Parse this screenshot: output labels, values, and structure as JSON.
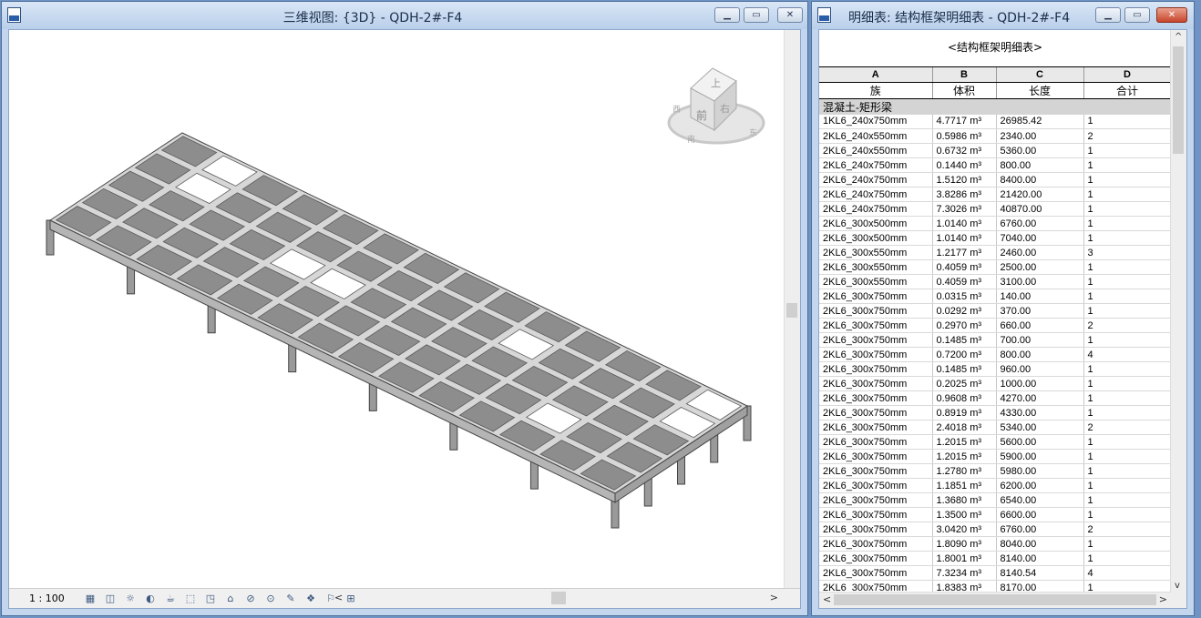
{
  "window_3d": {
    "title": "三维视图: {3D} - QDH-2#-F4",
    "scale": "1 : 100",
    "viewcube": {
      "top": "上",
      "front": "前",
      "right": "右",
      "ring_left": "西",
      "ring_front": "南",
      "ring_right": "东"
    },
    "view_controls": [
      "detail-level-icon",
      "visual-style-icon",
      "sun-path-icon",
      "shadows-icon",
      "render-icon",
      "crop-view-icon",
      "show-crop-icon",
      "unlock-3d-icon",
      "temporary-hide-icon",
      "reveal-hidden-icon",
      "highlight-icon",
      "analytical-model-icon",
      "worksharing-icon",
      "design-options-icon"
    ]
  },
  "window_schedule": {
    "title": "明细表: 结构框架明细表 - QDH-2#-F4",
    "schedule_title": "<结构框架明细表>",
    "column_letters": [
      "A",
      "B",
      "C",
      "D"
    ],
    "column_headers": [
      "族",
      "体积",
      "长度",
      "合计"
    ],
    "group_name": "混凝土-矩形梁",
    "rows": [
      [
        "1KL6_240x750mm",
        "4.7717 m³",
        "26985.42",
        "1"
      ],
      [
        "2KL6_240x550mm",
        "0.5986 m³",
        "2340.00",
        "2"
      ],
      [
        "2KL6_240x550mm",
        "0.6732 m³",
        "5360.00",
        "1"
      ],
      [
        "2KL6_240x750mm",
        "0.1440 m³",
        "800.00",
        "1"
      ],
      [
        "2KL6_240x750mm",
        "1.5120 m³",
        "8400.00",
        "1"
      ],
      [
        "2KL6_240x750mm",
        "3.8286 m³",
        "21420.00",
        "1"
      ],
      [
        "2KL6_240x750mm",
        "7.3026 m³",
        "40870.00",
        "1"
      ],
      [
        "2KL6_300x500mm",
        "1.0140 m³",
        "6760.00",
        "1"
      ],
      [
        "2KL6_300x500mm",
        "1.0140 m³",
        "7040.00",
        "1"
      ],
      [
        "2KL6_300x550mm",
        "1.2177 m³",
        "2460.00",
        "3"
      ],
      [
        "2KL6_300x550mm",
        "0.4059 m³",
        "2500.00",
        "1"
      ],
      [
        "2KL6_300x550mm",
        "0.4059 m³",
        "3100.00",
        "1"
      ],
      [
        "2KL6_300x750mm",
        "0.0315 m³",
        "140.00",
        "1"
      ],
      [
        "2KL6_300x750mm",
        "0.0292 m³",
        "370.00",
        "1"
      ],
      [
        "2KL6_300x750mm",
        "0.2970 m³",
        "660.00",
        "2"
      ],
      [
        "2KL6_300x750mm",
        "0.1485 m³",
        "700.00",
        "1"
      ],
      [
        "2KL6_300x750mm",
        "0.7200 m³",
        "800.00",
        "4"
      ],
      [
        "2KL6_300x750mm",
        "0.1485 m³",
        "960.00",
        "1"
      ],
      [
        "2KL6_300x750mm",
        "0.2025 m³",
        "1000.00",
        "1"
      ],
      [
        "2KL6_300x750mm",
        "0.9608 m³",
        "4270.00",
        "1"
      ],
      [
        "2KL6_300x750mm",
        "0.8919 m³",
        "4330.00",
        "1"
      ],
      [
        "2KL6_300x750mm",
        "2.4018 m³",
        "5340.00",
        "2"
      ],
      [
        "2KL6_300x750mm",
        "1.2015 m³",
        "5600.00",
        "1"
      ],
      [
        "2KL6_300x750mm",
        "1.2015 m³",
        "5900.00",
        "1"
      ],
      [
        "2KL6_300x750mm",
        "1.2780 m³",
        "5980.00",
        "1"
      ],
      [
        "2KL6_300x750mm",
        "1.1851 m³",
        "6200.00",
        "1"
      ],
      [
        "2KL6_300x750mm",
        "1.3680 m³",
        "6540.00",
        "1"
      ],
      [
        "2KL6_300x750mm",
        "1.3500 m³",
        "6600.00",
        "1"
      ],
      [
        "2KL6_300x750mm",
        "3.0420 m³",
        "6760.00",
        "2"
      ],
      [
        "2KL6_300x750mm",
        "1.8090 m³",
        "8040.00",
        "1"
      ],
      [
        "2KL6_300x750mm",
        "1.8001 m³",
        "8140.00",
        "1"
      ],
      [
        "2KL6_300x750mm",
        "7.3234 m³",
        "8140.54",
        "4"
      ],
      [
        "2KL6_300x750mm",
        "1.8383 m³",
        "8170.00",
        "1"
      ]
    ]
  },
  "colors": {
    "window_frame": "#c3d6ee",
    "slab": "#8d8d8d",
    "beam": "#d7d7d7",
    "group_row": "#d4d4d4"
  }
}
